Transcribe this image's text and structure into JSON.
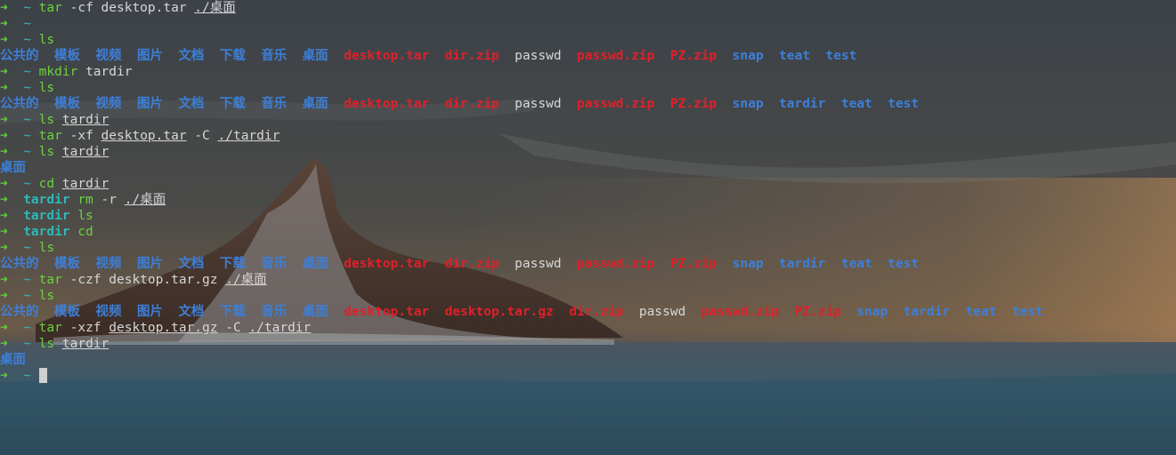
{
  "terminal": {
    "prompt_arrow": "➜",
    "home": "~",
    "colors": {
      "arrow": "#5fcf3a",
      "cwd": "#2fb8b8",
      "command": "#6cd23e",
      "directory": "#3d7fd9",
      "archive": "#e0202a",
      "plain_file": "#d7d7d7"
    },
    "lines": [
      {
        "type": "prompt",
        "cwd": "~",
        "cmd": "tar",
        "args": [
          {
            "t": "-cf desktop.tar"
          },
          {
            "t": "./桌面",
            "path": true
          }
        ]
      },
      {
        "type": "prompt",
        "cwd": "~",
        "cmd": "",
        "args": []
      },
      {
        "type": "prompt",
        "cwd": "~",
        "cmd": "ls",
        "args": []
      },
      {
        "type": "ls",
        "items": [
          {
            "n": "公共的",
            "k": "dir"
          },
          {
            "n": "模板",
            "k": "dir"
          },
          {
            "n": "视频",
            "k": "dir"
          },
          {
            "n": "图片",
            "k": "dir"
          },
          {
            "n": "文档",
            "k": "dir"
          },
          {
            "n": "下载",
            "k": "dir"
          },
          {
            "n": "音乐",
            "k": "dir"
          },
          {
            "n": "桌面",
            "k": "dir"
          },
          {
            "n": "desktop.tar",
            "k": "arch"
          },
          {
            "n": "dir.zip",
            "k": "arch"
          },
          {
            "n": "passwd",
            "k": "file"
          },
          {
            "n": "passwd.zip",
            "k": "arch"
          },
          {
            "n": "PZ.zip",
            "k": "arch"
          },
          {
            "n": "snap",
            "k": "dir"
          },
          {
            "n": "teat",
            "k": "dir"
          },
          {
            "n": "test",
            "k": "dir"
          }
        ]
      },
      {
        "type": "prompt",
        "cwd": "~",
        "cmd": "mkdir",
        "args": [
          {
            "t": "tardir"
          }
        ]
      },
      {
        "type": "prompt",
        "cwd": "~",
        "cmd": "ls",
        "args": []
      },
      {
        "type": "ls",
        "items": [
          {
            "n": "公共的",
            "k": "dir"
          },
          {
            "n": "模板",
            "k": "dir"
          },
          {
            "n": "视频",
            "k": "dir"
          },
          {
            "n": "图片",
            "k": "dir"
          },
          {
            "n": "文档",
            "k": "dir"
          },
          {
            "n": "下载",
            "k": "dir"
          },
          {
            "n": "音乐",
            "k": "dir"
          },
          {
            "n": "桌面",
            "k": "dir"
          },
          {
            "n": "desktop.tar",
            "k": "arch"
          },
          {
            "n": "dir.zip",
            "k": "arch"
          },
          {
            "n": "passwd",
            "k": "file"
          },
          {
            "n": "passwd.zip",
            "k": "arch"
          },
          {
            "n": "PZ.zip",
            "k": "arch"
          },
          {
            "n": "snap",
            "k": "dir"
          },
          {
            "n": "tardir",
            "k": "dir"
          },
          {
            "n": "teat",
            "k": "dir"
          },
          {
            "n": "test",
            "k": "dir"
          }
        ]
      },
      {
        "type": "prompt",
        "cwd": "~",
        "cmd": "ls",
        "args": [
          {
            "t": "tardir",
            "path": true
          }
        ]
      },
      {
        "type": "prompt",
        "cwd": "~",
        "cmd": "tar",
        "args": [
          {
            "t": "-xf"
          },
          {
            "t": "desktop.tar",
            "path": true
          },
          {
            "t": "-C"
          },
          {
            "t": "./tardir",
            "path": true
          }
        ]
      },
      {
        "type": "prompt",
        "cwd": "~",
        "cmd": "ls",
        "args": [
          {
            "t": "tardir",
            "path": true
          }
        ]
      },
      {
        "type": "ls",
        "items": [
          {
            "n": "桌面",
            "k": "dir"
          }
        ]
      },
      {
        "type": "prompt",
        "cwd": "~",
        "cmd": "cd",
        "args": [
          {
            "t": "tardir",
            "path": true
          }
        ]
      },
      {
        "type": "prompt",
        "cwd": "tardir",
        "cmd": "rm",
        "args": [
          {
            "t": "-r"
          },
          {
            "t": "./桌面",
            "path": true
          }
        ]
      },
      {
        "type": "prompt",
        "cwd": "tardir",
        "cmd": "ls",
        "args": []
      },
      {
        "type": "prompt",
        "cwd": "tardir",
        "cmd": "cd",
        "args": []
      },
      {
        "type": "prompt",
        "cwd": "~",
        "cmd": "ls",
        "args": []
      },
      {
        "type": "ls",
        "items": [
          {
            "n": "公共的",
            "k": "dir"
          },
          {
            "n": "模板",
            "k": "dir"
          },
          {
            "n": "视频",
            "k": "dir"
          },
          {
            "n": "图片",
            "k": "dir"
          },
          {
            "n": "文档",
            "k": "dir"
          },
          {
            "n": "下载",
            "k": "dir"
          },
          {
            "n": "音乐",
            "k": "dir"
          },
          {
            "n": "桌面",
            "k": "dir"
          },
          {
            "n": "desktop.tar",
            "k": "arch"
          },
          {
            "n": "dir.zip",
            "k": "arch"
          },
          {
            "n": "passwd",
            "k": "file"
          },
          {
            "n": "passwd.zip",
            "k": "arch"
          },
          {
            "n": "PZ.zip",
            "k": "arch"
          },
          {
            "n": "snap",
            "k": "dir"
          },
          {
            "n": "tardir",
            "k": "dir"
          },
          {
            "n": "teat",
            "k": "dir"
          },
          {
            "n": "test",
            "k": "dir"
          }
        ]
      },
      {
        "type": "prompt",
        "cwd": "~",
        "cmd": "tar",
        "args": [
          {
            "t": "-czf desktop.tar.gz"
          },
          {
            "t": "./桌面",
            "path": true
          }
        ]
      },
      {
        "type": "prompt",
        "cwd": "~",
        "cmd": "ls",
        "args": []
      },
      {
        "type": "ls",
        "items": [
          {
            "n": "公共的",
            "k": "dir"
          },
          {
            "n": "模板",
            "k": "dir"
          },
          {
            "n": "视频",
            "k": "dir"
          },
          {
            "n": "图片",
            "k": "dir"
          },
          {
            "n": "文档",
            "k": "dir"
          },
          {
            "n": "下载",
            "k": "dir"
          },
          {
            "n": "音乐",
            "k": "dir"
          },
          {
            "n": "桌面",
            "k": "dir"
          },
          {
            "n": "desktop.tar",
            "k": "arch"
          },
          {
            "n": "desktop.tar.gz",
            "k": "arch"
          },
          {
            "n": "dir.zip",
            "k": "arch"
          },
          {
            "n": "passwd",
            "k": "file"
          },
          {
            "n": "passwd.zip",
            "k": "arch"
          },
          {
            "n": "PZ.zip",
            "k": "arch"
          },
          {
            "n": "snap",
            "k": "dir"
          },
          {
            "n": "tardir",
            "k": "dir"
          },
          {
            "n": "teat",
            "k": "dir"
          },
          {
            "n": "test",
            "k": "dir"
          }
        ]
      },
      {
        "type": "prompt",
        "cwd": "~",
        "cmd": "tar",
        "args": [
          {
            "t": "-xzf"
          },
          {
            "t": "desktop.tar.gz",
            "path": true
          },
          {
            "t": "-C"
          },
          {
            "t": "./tardir",
            "path": true
          }
        ]
      },
      {
        "type": "prompt",
        "cwd": "~",
        "cmd": "ls",
        "args": [
          {
            "t": "tardir",
            "path": true
          }
        ]
      },
      {
        "type": "ls",
        "items": [
          {
            "n": "桌面",
            "k": "dir"
          }
        ]
      },
      {
        "type": "prompt",
        "cwd": "~",
        "cmd": "",
        "args": [],
        "cursor": true
      }
    ]
  }
}
